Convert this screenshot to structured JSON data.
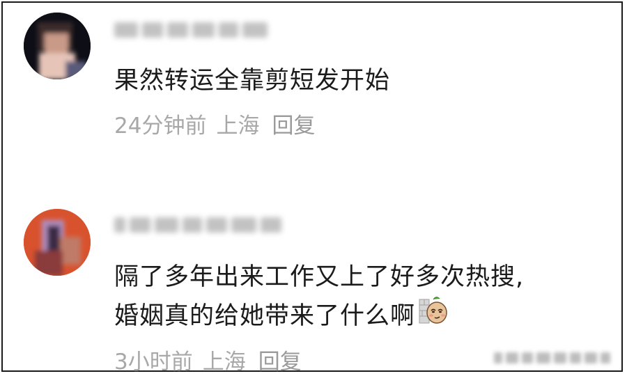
{
  "comments": [
    {
      "text": "果然转运全靠剪短发开始",
      "time": "24分钟前",
      "location": "上海",
      "reply_label": "回复"
    },
    {
      "text_line1": "隔了多年出来工作又上了好多次热搜,",
      "text_line2": "婚姻真的给她带来了什么啊",
      "time": "3小时前",
      "location": "上海",
      "reply_label": "回复",
      "emoji": "sly-peanut-emoji"
    }
  ],
  "colors": {
    "text": "#1b1b1b",
    "meta": "#a8a8a8",
    "frame": "#1a1a1a"
  }
}
